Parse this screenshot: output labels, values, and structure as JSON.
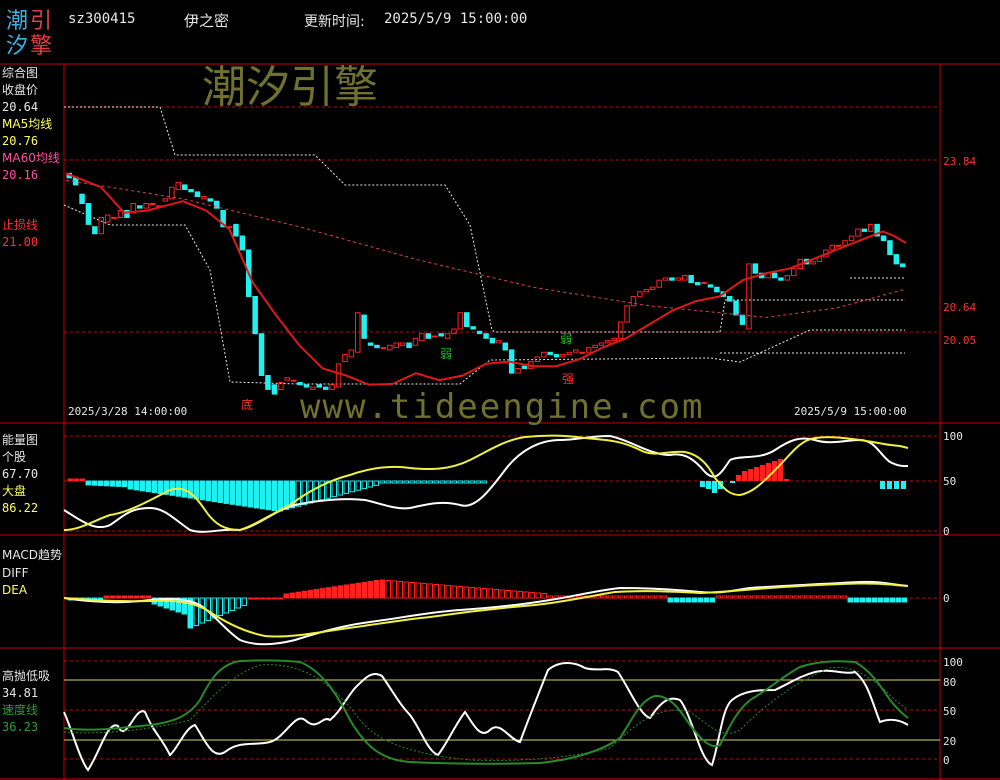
{
  "header": {
    "logo_chars": [
      "潮",
      "引",
      "汐",
      "擎"
    ],
    "code": "sz300415",
    "name": "伊之密",
    "update_label": "更新时间:",
    "update_time": "2025/5/9 15:00:00"
  },
  "watermarks": {
    "brand": "潮汐引擎",
    "url": "www.tideengine.com"
  },
  "colors": {
    "background": "#000000",
    "panel_border": "#c00000",
    "up": "#ff2020",
    "down": "#20f0f0",
    "ma5": "#ffff60",
    "ma60": "#ff50a0",
    "stop_loss": "#ff3030",
    "white_line": "#ffffff",
    "green_line": "#2a8a2a"
  },
  "panels": {
    "main": {
      "title": "综合图",
      "rows": [
        {
          "label": "收盘价",
          "value": "20.64",
          "color": "#e8e8e8"
        },
        {
          "label": "MA5均线",
          "value": "20.76",
          "color": "#ffff60"
        },
        {
          "label": "MA60均线",
          "value": "20.16",
          "color": "#ff50a0"
        },
        {
          "label": "止损线",
          "value": "21.00",
          "color": "#ff3030"
        }
      ],
      "right_axis": [
        "23.84",
        "20.64",
        "20.05"
      ],
      "start_date": "2025/3/28 14:00:00",
      "end_date": "2025/5/9 15:00:00",
      "markers": [
        {
          "text": "底",
          "color": "#ff3030"
        },
        {
          "text": "弱",
          "color": "#20c020"
        },
        {
          "text": "弱",
          "color": "#20c020"
        },
        {
          "text": "强",
          "color": "#ff3030"
        }
      ]
    },
    "energy": {
      "title": "能量图",
      "rows": [
        {
          "label": "个股",
          "value": "67.70",
          "color": "#e8e8e8"
        },
        {
          "label": "大盘",
          "value": "86.22",
          "color": "#ffff60"
        }
      ],
      "right_axis": [
        "100",
        "50",
        "0"
      ]
    },
    "macd": {
      "title": "MACD趋势",
      "rows": [
        {
          "label": "DIFF",
          "value": "",
          "color": "#e8e8e8"
        },
        {
          "label": "DEA",
          "value": "",
          "color": "#ffff60"
        }
      ],
      "right_axis": [
        "0"
      ]
    },
    "kdj": {
      "title": "高抛低吸",
      "rows": [
        {
          "label": "",
          "value": "34.81",
          "color": "#e8e8e8"
        },
        {
          "label": "速度线",
          "value": "36.23",
          "color": "#2a8a2a"
        }
      ],
      "right_axis": [
        "100",
        "80",
        "50",
        "20",
        "0"
      ]
    }
  },
  "chart_data": {
    "type": "candlestick",
    "x_start": "2025/3/28 14:00:00",
    "x_end": "2025/5/9 15:00:00",
    "bars": 116,
    "price_ylim": [
      17.3,
      25.0
    ],
    "price_ticks": [
      23.84,
      20.64,
      20.05
    ],
    "candles": [
      [
        22.65,
        22.55
      ],
      [
        22.55,
        22.4
      ],
      [
        22.2,
        22.0
      ],
      [
        22.0,
        21.55
      ],
      [
        21.5,
        21.35
      ],
      [
        21.35,
        21.7
      ],
      [
        21.6,
        21.75
      ],
      [
        21.7,
        21.7
      ],
      [
        21.7,
        21.85
      ],
      [
        21.85,
        21.7
      ],
      [
        21.8,
        22.0
      ],
      [
        21.95,
        21.9
      ],
      [
        21.9,
        22.0
      ],
      [
        22.0,
        22.0
      ],
      [
        21.95,
        21.95
      ],
      [
        22.05,
        22.1
      ],
      [
        22.1,
        22.35
      ],
      [
        22.3,
        22.45
      ],
      [
        22.4,
        22.3
      ],
      [
        22.3,
        22.25
      ],
      [
        22.25,
        22.15
      ],
      [
        22.1,
        22.15
      ],
      [
        22.1,
        22.05
      ],
      [
        22.05,
        21.9
      ],
      [
        21.85,
        21.5
      ],
      [
        21.5,
        21.5
      ],
      [
        21.55,
        21.3
      ],
      [
        21.3,
        21.0
      ],
      [
        21.0,
        20.0
      ],
      [
        20.0,
        19.2
      ],
      [
        19.2,
        18.3
      ],
      [
        18.3,
        18.0
      ],
      [
        18.1,
        17.9
      ],
      [
        18.0,
        18.15
      ],
      [
        18.2,
        18.25
      ],
      [
        18.2,
        18.2
      ],
      [
        18.15,
        18.1
      ],
      [
        18.1,
        18.05
      ],
      [
        18.0,
        18.05
      ],
      [
        18.1,
        18.05
      ],
      [
        18.05,
        18.0
      ],
      [
        18.0,
        18.1
      ],
      [
        18.05,
        18.55
      ],
      [
        18.6,
        18.75
      ],
      [
        18.7,
        18.85
      ],
      [
        18.8,
        19.65
      ],
      [
        19.6,
        19.1
      ],
      [
        19.0,
        18.95
      ],
      [
        18.95,
        18.9
      ],
      [
        18.9,
        18.9
      ],
      [
        18.85,
        18.95
      ],
      [
        18.9,
        19.0
      ],
      [
        18.95,
        19.0
      ],
      [
        19.0,
        18.9
      ],
      [
        18.95,
        19.1
      ],
      [
        19.05,
        19.2
      ],
      [
        19.2,
        19.1
      ],
      [
        19.15,
        19.15
      ],
      [
        19.2,
        19.15
      ],
      [
        19.1,
        19.2
      ],
      [
        19.2,
        19.3
      ],
      [
        19.3,
        19.65
      ],
      [
        19.65,
        19.35
      ],
      [
        19.35,
        19.3
      ],
      [
        19.25,
        19.2
      ],
      [
        19.2,
        19.1
      ],
      [
        19.1,
        19.0
      ],
      [
        19.0,
        19.05
      ],
      [
        19.0,
        18.85
      ],
      [
        18.85,
        18.35
      ],
      [
        18.35,
        18.45
      ],
      [
        18.5,
        18.45
      ],
      [
        18.45,
        18.6
      ],
      [
        18.6,
        18.7
      ],
      [
        18.7,
        18.8
      ],
      [
        18.8,
        18.75
      ],
      [
        18.75,
        18.7
      ],
      [
        18.7,
        18.75
      ],
      [
        18.75,
        18.8
      ],
      [
        18.8,
        18.85
      ],
      [
        18.8,
        18.8
      ],
      [
        18.8,
        18.9
      ],
      [
        18.9,
        18.95
      ],
      [
        18.95,
        19.0
      ],
      [
        19.0,
        19.05
      ],
      [
        19.05,
        19.1
      ],
      [
        19.1,
        19.45
      ],
      [
        19.45,
        19.8
      ],
      [
        19.8,
        20.0
      ],
      [
        20.0,
        20.1
      ],
      [
        20.1,
        20.15
      ],
      [
        20.15,
        20.2
      ],
      [
        20.2,
        20.35
      ],
      [
        20.35,
        20.4
      ],
      [
        20.4,
        20.35
      ],
      [
        20.35,
        20.4
      ],
      [
        20.35,
        20.45
      ],
      [
        20.45,
        20.3
      ],
      [
        20.3,
        20.25
      ],
      [
        20.3,
        20.3
      ],
      [
        20.25,
        20.2
      ],
      [
        20.2,
        20.1
      ],
      [
        20.1,
        20.0
      ],
      [
        20.0,
        19.9
      ],
      [
        19.9,
        19.6
      ],
      [
        19.6,
        19.4
      ],
      [
        19.3,
        20.7
      ],
      [
        20.7,
        20.5
      ],
      [
        20.5,
        20.4
      ],
      [
        20.4,
        20.5
      ],
      [
        20.5,
        20.4
      ],
      [
        20.4,
        20.35
      ],
      [
        20.35,
        20.45
      ],
      [
        20.45,
        20.6
      ],
      [
        20.6,
        20.8
      ],
      [
        20.8,
        20.7
      ],
      [
        20.7,
        20.75
      ],
      [
        20.75,
        20.85
      ],
      [
        20.85,
        21.0
      ],
      [
        21.0,
        21.1
      ],
      [
        21.1,
        21.1
      ],
      [
        21.1,
        21.2
      ],
      [
        21.2,
        21.3
      ],
      [
        21.3,
        21.45
      ],
      [
        21.45,
        21.4
      ],
      [
        21.4,
        21.55
      ],
      [
        21.55,
        21.3
      ],
      [
        21.3,
        21.2
      ],
      [
        21.2,
        20.9
      ],
      [
        20.9,
        20.7
      ],
      [
        20.7,
        20.64
      ]
    ],
    "ma5": [
      [
        0,
        22.65
      ],
      [
        6,
        22.35
      ],
      [
        10,
        21.8
      ],
      [
        14,
        21.85
      ],
      [
        20,
        22.05
      ],
      [
        24,
        21.85
      ],
      [
        28,
        21.45
      ],
      [
        32,
        20.3
      ],
      [
        36,
        19.6
      ],
      [
        40,
        18.95
      ],
      [
        44,
        18.45
      ],
      [
        48,
        18.3
      ],
      [
        52,
        18.1
      ],
      [
        56,
        18.12
      ],
      [
        60,
        18.35
      ],
      [
        64,
        18.2
      ],
      [
        68,
        18.3
      ],
      [
        72,
        18.55
      ],
      [
        76,
        18.6
      ],
      [
        80,
        18.5
      ],
      [
        84,
        18.5
      ],
      [
        88,
        18.65
      ],
      [
        92,
        18.9
      ],
      [
        96,
        19.1
      ],
      [
        100,
        19.4
      ],
      [
        104,
        19.7
      ],
      [
        108,
        19.9
      ],
      [
        112,
        20.0
      ],
      [
        116,
        20.35
      ],
      [
        120,
        20.5
      ],
      [
        124,
        20.6
      ],
      [
        128,
        20.8
      ],
      [
        132,
        21.0
      ],
      [
        136,
        21.2
      ],
      [
        140,
        21.4
      ],
      [
        142,
        21.3
      ],
      [
        144,
        21.15
      ]
    ],
    "ma60": [
      [
        0,
        22.5
      ],
      [
        20,
        22.1
      ],
      [
        40,
        21.5
      ],
      [
        60,
        20.8
      ],
      [
        80,
        20.2
      ],
      [
        100,
        19.8
      ],
      [
        112,
        19.65
      ],
      [
        120,
        19.55
      ],
      [
        132,
        19.75
      ],
      [
        144,
        20.16
      ]
    ],
    "stop_loss_level": 21.0
  }
}
